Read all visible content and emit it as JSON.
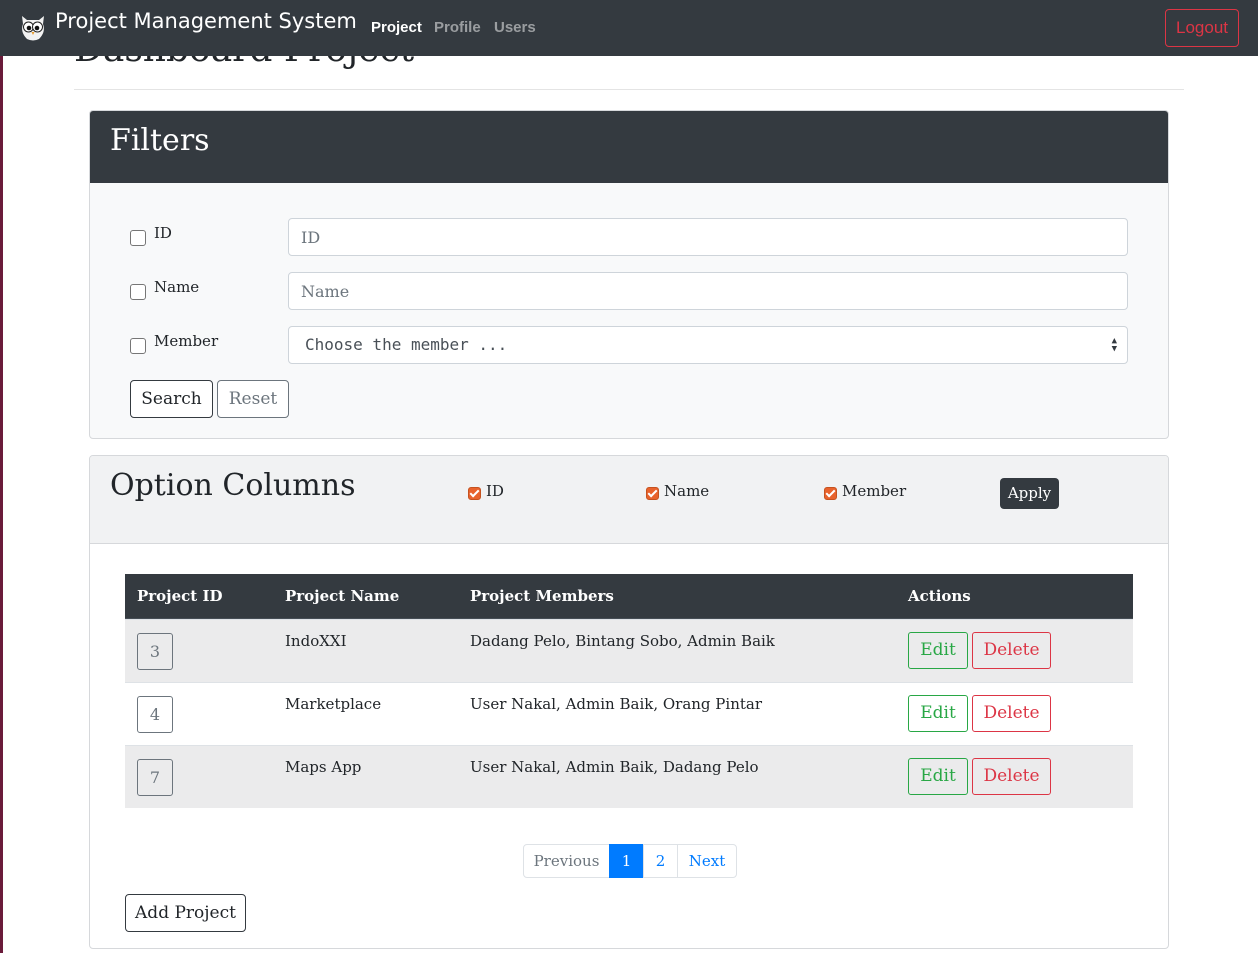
{
  "navbar": {
    "brand": "Project Management System",
    "links": [
      "Project",
      "Profile",
      "Users"
    ],
    "active_link": "Project",
    "logout_label": "Logout"
  },
  "page": {
    "title": "Dashboard Project"
  },
  "filters": {
    "title": "Filters",
    "id_label": "ID",
    "id_placeholder": "ID",
    "name_label": "Name",
    "name_placeholder": "Name",
    "member_label": "Member",
    "member_select_value": "Choose the member ...",
    "search_label": "Search",
    "reset_label": "Reset"
  },
  "option_columns": {
    "title": "Option Columns",
    "options": [
      {
        "label": "ID",
        "checked": true
      },
      {
        "label": "Name",
        "checked": true
      },
      {
        "label": "Member",
        "checked": true
      }
    ],
    "apply_label": "Apply"
  },
  "table": {
    "headers": [
      "Project ID",
      "Project Name",
      "Project Members",
      "Actions"
    ],
    "rows": [
      {
        "id": "3",
        "name": "IndoXXI",
        "members": "Dadang Pelo, Bintang Sobo, Admin Baik"
      },
      {
        "id": "4",
        "name": "Marketplace",
        "members": "User Nakal, Admin Baik, Orang Pintar"
      },
      {
        "id": "7",
        "name": "Maps App",
        "members": "User Nakal, Admin Baik, Dadang Pelo"
      }
    ],
    "edit_label": "Edit",
    "delete_label": "Delete"
  },
  "pagination": {
    "previous": "Previous",
    "pages": [
      "1",
      "2"
    ],
    "current_page": "1",
    "next": "Next"
  },
  "add_project_label": "Add Project",
  "colors": {
    "navbar": "#343a40",
    "danger": "#dc3545",
    "success": "#28a745",
    "primary": "#007bff",
    "checkbox_accent": "#e8622c"
  }
}
